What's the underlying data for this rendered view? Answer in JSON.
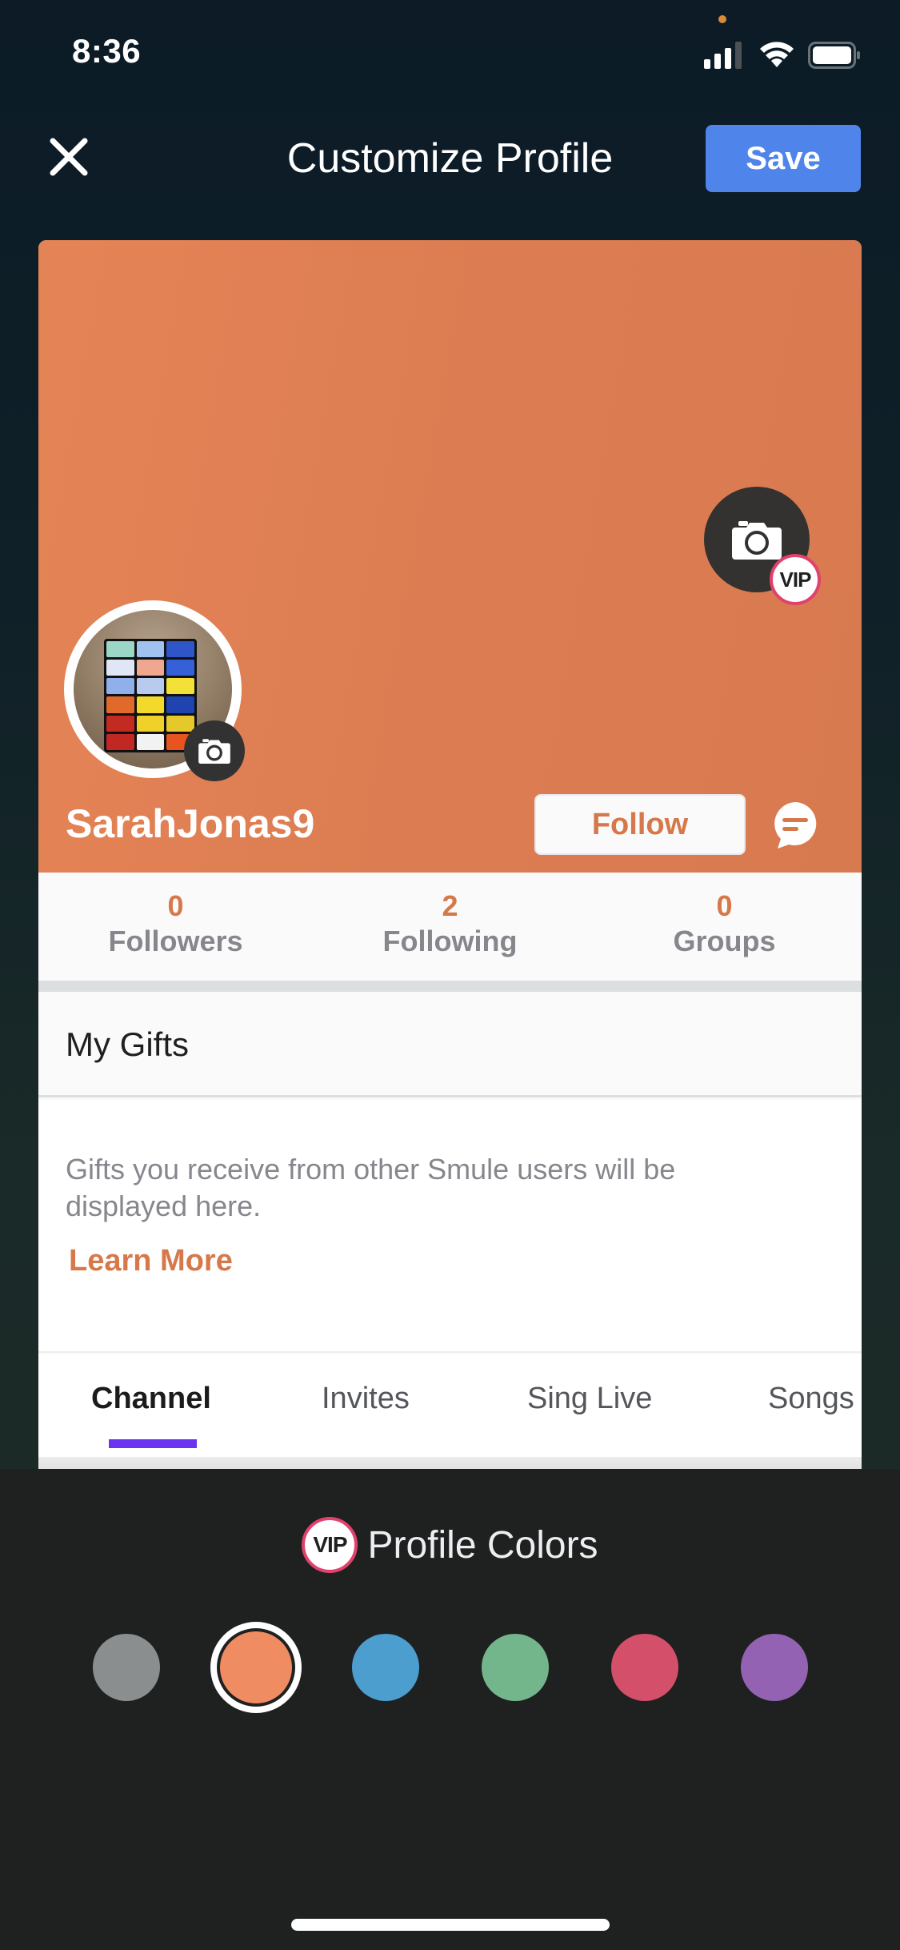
{
  "status_bar": {
    "time": "8:36",
    "icons": [
      "signal-icon",
      "wifi-icon",
      "battery-icon"
    ]
  },
  "nav": {
    "close_icon": "close-icon",
    "title": "Customize Profile",
    "save_label": "Save"
  },
  "profile": {
    "banner_color": "#e08254",
    "cover_camera_icon": "camera-icon",
    "vip_label": "VIP",
    "username": "SarahJonas9",
    "follow_label": "Follow",
    "message_icon": "chat-bubble-icon",
    "avatar_description": "Rubik's cube photo"
  },
  "stats": [
    {
      "value": "0",
      "label": "Followers"
    },
    {
      "value": "2",
      "label": "Following"
    },
    {
      "value": "0",
      "label": "Groups"
    }
  ],
  "gifts": {
    "title": "My Gifts",
    "description": "Gifts you receive from other Smule users will be displayed here.",
    "learn_more": "Learn More"
  },
  "tabs": [
    {
      "label": "Channel",
      "active": true
    },
    {
      "label": "Invites",
      "active": false
    },
    {
      "label": "Sing Live",
      "active": false
    },
    {
      "label": "Songs",
      "active": false
    }
  ],
  "profile_colors": {
    "vip_label": "VIP",
    "title": "Profile Colors",
    "selected_index": 1,
    "swatches": [
      {
        "name": "gray",
        "hex": "#8a8e8e"
      },
      {
        "name": "orange",
        "hex": "#ef8c62"
      },
      {
        "name": "blue",
        "hex": "#4b9ecd"
      },
      {
        "name": "green",
        "hex": "#74b68b"
      },
      {
        "name": "red",
        "hex": "#d44f69"
      },
      {
        "name": "purple",
        "hex": "#9462b3"
      }
    ]
  },
  "colors": {
    "accent_orange": "#d6784a",
    "save_blue": "#4f85ea",
    "tab_underline": "#6a34f2",
    "vip_ring": "#e0426d"
  }
}
